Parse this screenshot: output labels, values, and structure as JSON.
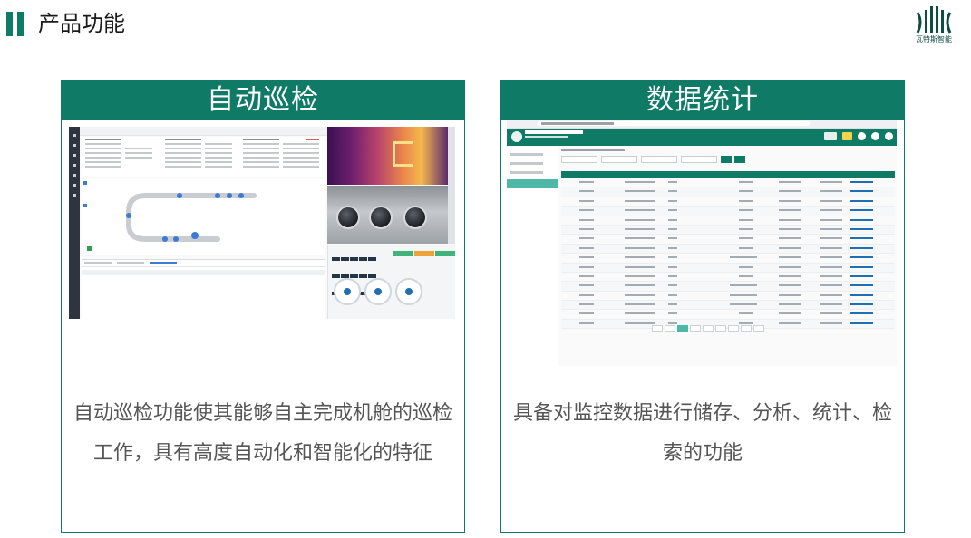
{
  "page": {
    "title": "产品功能",
    "logo_text": "瓦特斯智能",
    "accent_color": "#0f7a66"
  },
  "cards": [
    {
      "heading": "自动巡检",
      "description": "自动巡检功能使其能够自主完成机舱的巡检工作，具有高度自动化和智能化的特征",
      "screenshot_icon": "inspection-ui-screenshot"
    },
    {
      "heading": "数据统计",
      "description": "具备对监控数据进行储存、分析、统计、检索的功能",
      "screenshot_icon": "data-statistics-ui-screenshot"
    }
  ]
}
